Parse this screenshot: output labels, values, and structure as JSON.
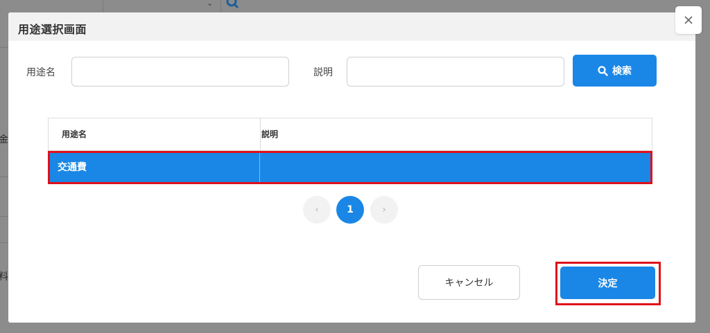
{
  "background": {
    "chevron": "⌄",
    "side_text_1": "金",
    "side_text_2": "料"
  },
  "modal": {
    "title": "用途選択画面",
    "close_icon": "close-icon"
  },
  "search": {
    "usage_label": "用途名",
    "usage_value": "",
    "description_label": "説明",
    "description_value": "",
    "button_label": "検索"
  },
  "table": {
    "columns": [
      "用途名",
      "説明"
    ],
    "rows": [
      {
        "name": "交通費",
        "description": ""
      }
    ]
  },
  "pagination": {
    "prev": "‹",
    "current": "1",
    "next": "›"
  },
  "footer": {
    "cancel_label": "キャンセル",
    "confirm_label": "決定"
  },
  "colors": {
    "accent": "#1a87e6",
    "highlight": "#e0101a",
    "overlay": "#8c8c8c"
  }
}
